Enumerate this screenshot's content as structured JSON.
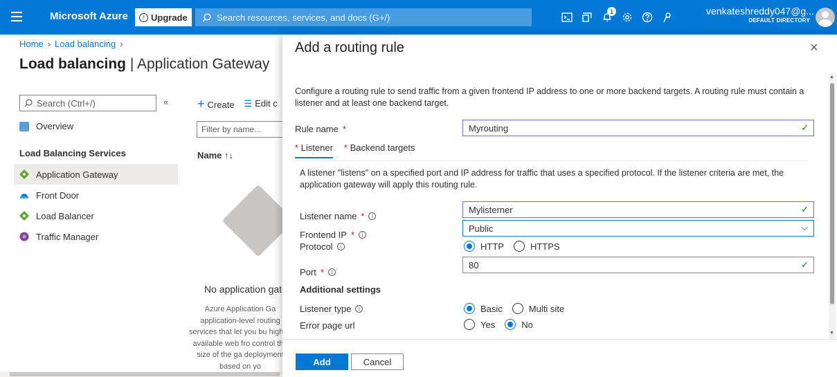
{
  "topbar": {
    "brand": "Microsoft Azure",
    "upgrade_label": "Upgrade",
    "search_placeholder": "Search resources, services, and docs (G+/)",
    "notification_count": "1",
    "user_name": "venkateshreddy047@g...",
    "user_directory": "DEFAULT DIRECTORY"
  },
  "background": {
    "breadcrumb": [
      "Home",
      "Load balancing"
    ],
    "title_bold": "Load balancing",
    "title_rest": " | Application Gateway",
    "left_search_placeholder": "Search (Ctrl+/)",
    "collapse_glyph": "«",
    "overview": "Overview",
    "section_label": "Load Balancing Services",
    "nav_items": [
      "Application Gateway",
      "Front Door",
      "Load Balancer",
      "Traffic Manager"
    ],
    "active_nav": "Application Gateway",
    "cmd_create": "Create",
    "cmd_edit": "Edit c",
    "filter_placeholder": "Filter by name...",
    "col_name": "Name ↑↓",
    "empty_title": "No application gate",
    "empty_desc": "Azure Application Ga application-level routing services that let you bu highly-available web fro control the size of the ga deployment based on yo"
  },
  "panel": {
    "title": "Add a routing rule",
    "close_glyph": "×",
    "description": "Configure a routing rule to send traffic from a given frontend IP address to one or more backend targets. A routing rule must contain a listener and at least one backend target.",
    "rule_name_label": "Rule name",
    "rule_name_value": "Myrouting",
    "tabs": [
      {
        "label": "Listener",
        "active": true
      },
      {
        "label": "Backend targets",
        "active": false
      }
    ],
    "listener_desc": "A listener \"listens\" on a specified port and IP address for traffic that uses a specified protocol. If the listener criteria are met, the application gateway will apply this routing rule.",
    "listener_name_label": "Listener name",
    "listener_name_value": "Mylisterner",
    "frontend_ip_label": "Frontend IP",
    "frontend_ip_value": "Public",
    "protocol_label": "Protocol",
    "protocol_options": [
      "HTTP",
      "HTTPS"
    ],
    "protocol_selected": "HTTP",
    "port_label": "Port",
    "port_value": "80",
    "additional_settings": "Additional settings",
    "listener_type_label": "Listener type",
    "listener_type_options": [
      "Basic",
      "Multi site"
    ],
    "listener_type_selected": "Basic",
    "error_page_label": "Error page url",
    "error_page_options": [
      "Yes",
      "No"
    ],
    "error_page_selected": "No",
    "add_label": "Add",
    "cancel_label": "Cancel"
  },
  "colors": {
    "accent": "#0078d4",
    "required": "#a4262c",
    "valid": "#107c10"
  }
}
